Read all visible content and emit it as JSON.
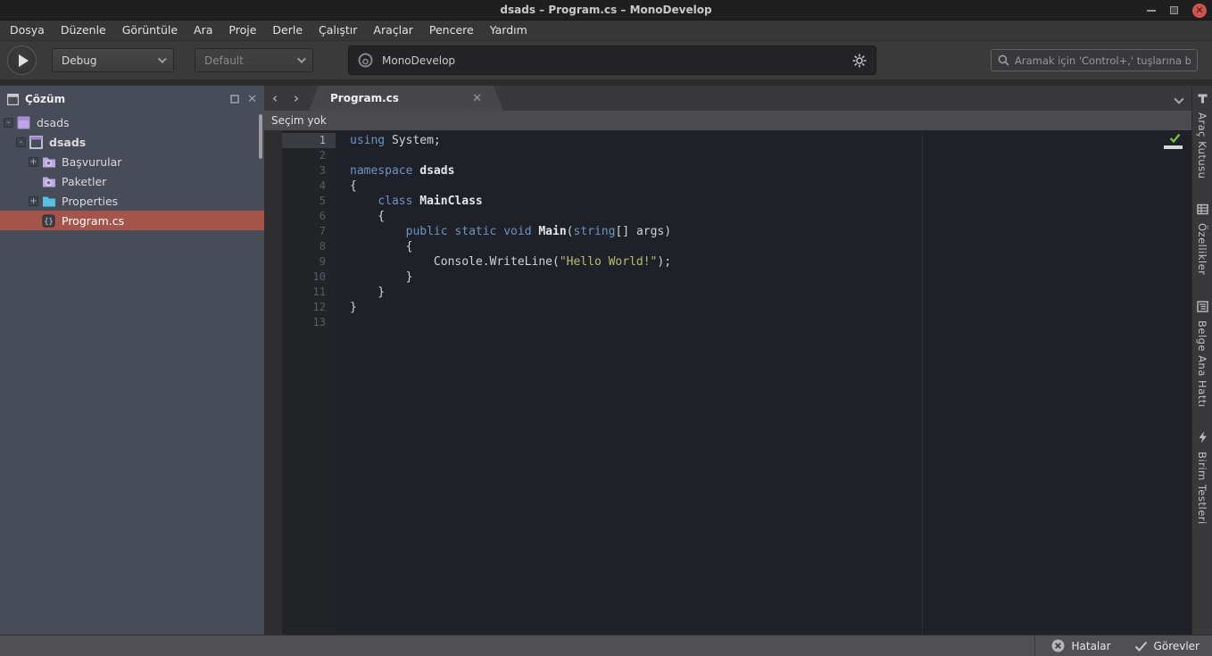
{
  "window": {
    "title": "dsads – Program.cs – MonoDevelop"
  },
  "menu": {
    "items": [
      "Dosya",
      "Düzenle",
      "Görüntüle",
      "Ara",
      "Proje",
      "Derle",
      "Çalıştır",
      "Araçlar",
      "Pencere",
      "Yardım"
    ]
  },
  "toolbar": {
    "configuration": "Debug",
    "target": "Default",
    "status_text": "MonoDevelop",
    "search_placeholder": "Aramak için 'Control+,' tuşlarına basın"
  },
  "solution_pad": {
    "title": "Çözüm",
    "tree": [
      {
        "label": "dsads",
        "icon": "solution",
        "level": 0,
        "expander": "-",
        "bold": false,
        "selected": false
      },
      {
        "label": "dsads",
        "icon": "project",
        "level": 1,
        "expander": "-",
        "bold": true,
        "selected": false
      },
      {
        "label": "Başvurular",
        "icon": "refs-folder",
        "level": 2,
        "expander": "+",
        "bold": false,
        "selected": false
      },
      {
        "label": "Paketler",
        "icon": "pkg-folder",
        "level": 2,
        "expander": "",
        "bold": false,
        "selected": false
      },
      {
        "label": "Properties",
        "icon": "folder",
        "level": 2,
        "expander": "+",
        "bold": false,
        "selected": false
      },
      {
        "label": "Program.cs",
        "icon": "cs-file",
        "level": 2,
        "expander": "",
        "bold": false,
        "selected": true
      }
    ]
  },
  "editor": {
    "tab_label": "Program.cs",
    "breadcrumb": "Seçim yok",
    "current_line": 1,
    "code_lines": [
      {
        "n": 1,
        "tokens": [
          [
            "kw",
            "using"
          ],
          [
            "pl",
            " System;"
          ]
        ]
      },
      {
        "n": 2,
        "tokens": []
      },
      {
        "n": 3,
        "tokens": [
          [
            "kw",
            "namespace"
          ],
          [
            "pl",
            " "
          ],
          [
            "bold",
            "dsads"
          ]
        ]
      },
      {
        "n": 4,
        "tokens": [
          [
            "pl",
            "{"
          ]
        ]
      },
      {
        "n": 5,
        "tokens": [
          [
            "pl",
            "    "
          ],
          [
            "kw",
            "class"
          ],
          [
            "pl",
            " "
          ],
          [
            "bold",
            "MainClass"
          ]
        ]
      },
      {
        "n": 6,
        "tokens": [
          [
            "pl",
            "    {"
          ]
        ]
      },
      {
        "n": 7,
        "tokens": [
          [
            "pl",
            "        "
          ],
          [
            "kw",
            "public"
          ],
          [
            "pl",
            " "
          ],
          [
            "kw",
            "static"
          ],
          [
            "pl",
            " "
          ],
          [
            "kw",
            "void"
          ],
          [
            "pl",
            " "
          ],
          [
            "bold",
            "Main"
          ],
          [
            "pl",
            "("
          ],
          [
            "kw",
            "string"
          ],
          [
            "pl",
            "[] args)"
          ]
        ]
      },
      {
        "n": 8,
        "tokens": [
          [
            "pl",
            "        {"
          ]
        ]
      },
      {
        "n": 9,
        "tokens": [
          [
            "pl",
            "            Console.WriteLine("
          ],
          [
            "str",
            "\"Hello World!\""
          ],
          [
            "pl",
            ");"
          ]
        ]
      },
      {
        "n": 10,
        "tokens": [
          [
            "pl",
            "        }"
          ]
        ]
      },
      {
        "n": 11,
        "tokens": [
          [
            "pl",
            "    }"
          ]
        ]
      },
      {
        "n": 12,
        "tokens": [
          [
            "pl",
            "}"
          ]
        ]
      },
      {
        "n": 13,
        "tokens": []
      }
    ]
  },
  "right_dock": {
    "tabs": [
      {
        "label": "Araç Kutusu",
        "icon": "toolbox"
      },
      {
        "label": "Özellikler",
        "icon": "properties"
      },
      {
        "label": "Belge Ana Hattı",
        "icon": "outline"
      },
      {
        "label": "Birim Testleri",
        "icon": "unit-tests"
      }
    ]
  },
  "status_bar": {
    "errors_label": "Hatalar",
    "tasks_label": "Görevler"
  },
  "colors": {
    "accent_selection": "#a5544c",
    "keyword": "#6c95c2",
    "string": "#b9bd6e",
    "editor_bg": "#1e2127",
    "sidebar_bg": "#484c58",
    "check_ok": "#76c043",
    "close_button": "#cc564e"
  }
}
